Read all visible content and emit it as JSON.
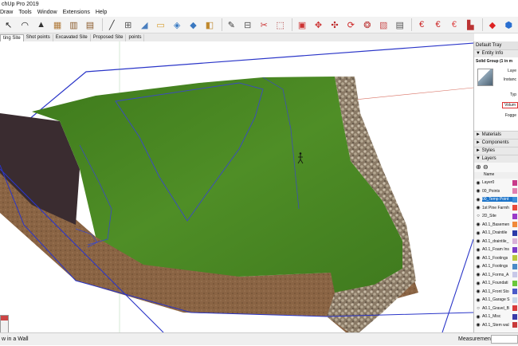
{
  "app": {
    "title": "chUp Pro 2019"
  },
  "menu": [
    "Draw",
    "Tools",
    "Window",
    "Extensions",
    "Help"
  ],
  "toolbar": {
    "buttons": [
      {
        "name": "select-icon",
        "glyph": "↖",
        "color": "#222"
      },
      {
        "name": "lasso-icon",
        "glyph": "◠",
        "color": "#222"
      },
      {
        "name": "eraser-icon",
        "glyph": "▲",
        "color": "#333"
      },
      {
        "name": "wall-icon",
        "glyph": "▦",
        "color": "#b07a3a"
      },
      {
        "name": "door-icon",
        "glyph": "▥",
        "color": "#8a5a2a"
      },
      {
        "name": "window-icon",
        "glyph": "▤",
        "color": "#8a5a2a"
      },
      {
        "name": "sep"
      },
      {
        "name": "line-icon",
        "glyph": "╱",
        "color": "#333"
      },
      {
        "name": "dimension-icon",
        "glyph": "⊞",
        "color": "#555"
      },
      {
        "name": "paint-bucket-icon",
        "glyph": "◢",
        "color": "#4a7fbf"
      },
      {
        "name": "section-icon",
        "glyph": "▭",
        "color": "#d69a2a"
      },
      {
        "name": "orbit-icon",
        "glyph": "◈",
        "color": "#3b7cc4"
      },
      {
        "name": "pan-icon",
        "glyph": "◆",
        "color": "#3a78c0"
      },
      {
        "name": "zoom-icon",
        "glyph": "◧",
        "color": "#c0892e"
      },
      {
        "name": "sep"
      },
      {
        "name": "tape-icon",
        "glyph": "✎",
        "color": "#333"
      },
      {
        "name": "protractor-icon",
        "glyph": "⊟",
        "color": "#555"
      },
      {
        "name": "scissors-icon",
        "glyph": "✂",
        "color": "#c33"
      },
      {
        "name": "trim-icon",
        "glyph": "⬚",
        "color": "#a33"
      },
      {
        "name": "sep"
      },
      {
        "name": "stamp-icon",
        "glyph": "▣",
        "color": "#c33"
      },
      {
        "name": "move-icon",
        "glyph": "✥",
        "color": "#c33"
      },
      {
        "name": "rotate-icon",
        "glyph": "✣",
        "color": "#b22"
      },
      {
        "name": "follow-me-icon",
        "glyph": "⟳",
        "color": "#c22"
      },
      {
        "name": "offset-icon",
        "glyph": "❂",
        "color": "#b33"
      },
      {
        "name": "push-pull-icon",
        "glyph": "▧",
        "color": "#c55"
      },
      {
        "name": "component-icon",
        "glyph": "▤",
        "color": "#555"
      },
      {
        "name": "sep"
      },
      {
        "name": "euro-icon",
        "glyph": "€",
        "color": "#c22"
      },
      {
        "name": "euro-tag-icon",
        "glyph": "€",
        "color": "#c22"
      },
      {
        "name": "euro-stack-icon",
        "glyph": "€",
        "color": "#d44"
      },
      {
        "name": "warehouse-icon",
        "glyph": "▙",
        "color": "#b33"
      },
      {
        "name": "sep"
      },
      {
        "name": "ruby-icon",
        "glyph": "◆",
        "color": "#d22"
      },
      {
        "name": "extension-cube-icon",
        "glyph": "⬢",
        "color": "#2a6fd0"
      }
    ]
  },
  "scenes": [
    "ting Site",
    "Shot points",
    "Excavated Site",
    "Proposed Site",
    "points"
  ],
  "tray": {
    "title": "Default Tray",
    "entity_info": {
      "header": "Entity Info",
      "name": "Solid Group (1 in m",
      "fields": [
        "Laye",
        "Instanc",
        "Typ",
        "Volum",
        "Fogge"
      ]
    },
    "panels": [
      "Materials",
      "Components",
      "Styles",
      "Layers"
    ],
    "layers_header": "Name",
    "layers": [
      {
        "name": "Layer0",
        "color": "#c83a8a",
        "selected": false,
        "visible": true
      },
      {
        "name": "00_Points",
        "color": "#e07fb0",
        "selected": false,
        "visible": true
      },
      {
        "name": "00_Temp Point",
        "color": "#3a8fd8",
        "selected": true,
        "visible": true
      },
      {
        "name": "1st Pine Farmh",
        "color": "#e84a3a",
        "selected": false,
        "visible": true
      },
      {
        "name": "2D_Site",
        "color": "#9a3ac8",
        "selected": false,
        "visible": false
      },
      {
        "name": "A0.1_Basemen",
        "color": "#f08a3a",
        "selected": false,
        "visible": true
      },
      {
        "name": "A0.1_Draintile",
        "color": "#2a3aa8",
        "selected": false,
        "visible": true
      },
      {
        "name": "A0.1_draintile_",
        "color": "#d8b0d8",
        "selected": false,
        "visible": true
      },
      {
        "name": "A0.1_Foam Ins",
        "color": "#7a3ac8",
        "selected": false,
        "visible": true
      },
      {
        "name": "A0.1_Footings",
        "color": "#b8c83a",
        "selected": false,
        "visible": true
      },
      {
        "name": "A0.1_Footings",
        "color": "#4a8ac8",
        "selected": false,
        "visible": true
      },
      {
        "name": "A0.1_Forms_A",
        "color": "#c8c8e8",
        "selected": false,
        "visible": true
      },
      {
        "name": "A0.1_Foundati",
        "color": "#6ac83a",
        "selected": false,
        "visible": true
      },
      {
        "name": "A0.1_Front Sto",
        "color": "#4a5ac8",
        "selected": false,
        "visible": true
      },
      {
        "name": "A0.1_Garage S",
        "color": "#c8d8e8",
        "selected": false,
        "visible": true
      },
      {
        "name": "A0.1_Gravel_B",
        "color": "#d83a3a",
        "selected": false,
        "visible": false
      },
      {
        "name": "A0.1_Misc",
        "color": "#3a3aa8",
        "selected": false,
        "visible": true
      },
      {
        "name": "A0.1_Stem wal",
        "color": "#c83a3a",
        "selected": false,
        "visible": true
      }
    ]
  },
  "status": {
    "hint": "w in a Wall",
    "measurements_label": "Measurements"
  }
}
